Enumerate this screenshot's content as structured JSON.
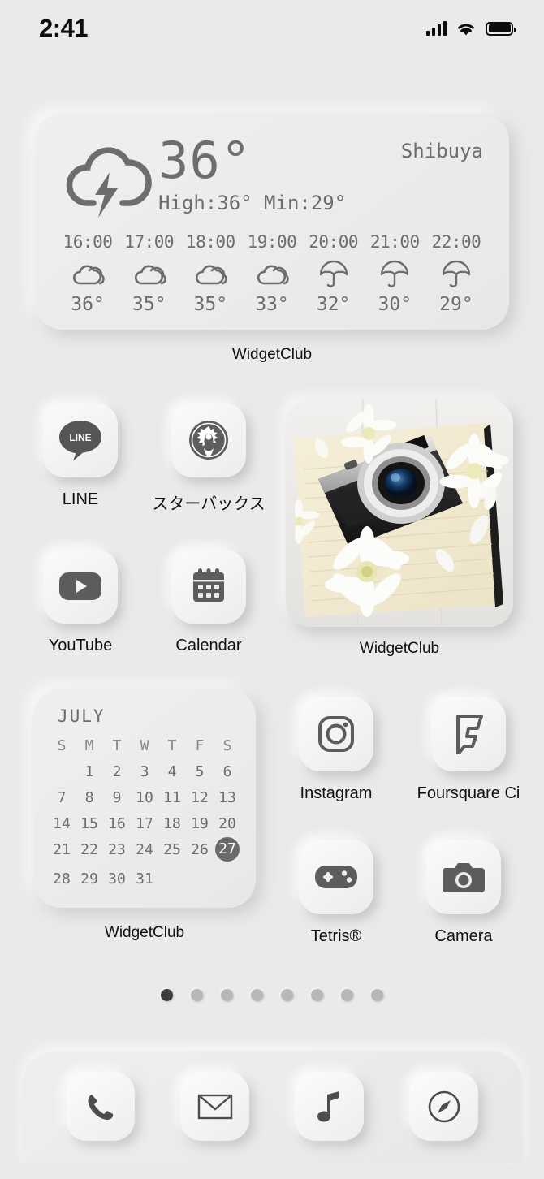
{
  "statusbar": {
    "time": "2:41",
    "signal_icon": "cellular-bars-icon",
    "wifi_icon": "wifi-icon",
    "battery_icon": "battery-full-icon"
  },
  "weather": {
    "condition_icon": "thunderstorm-icon",
    "temperature": "36°",
    "high_low": "High:36° Min:29°",
    "location": "Shibuya",
    "hourly": [
      {
        "time": "16:00",
        "icon": "cloudy-icon",
        "temp": "36°"
      },
      {
        "time": "17:00",
        "icon": "cloudy-icon",
        "temp": "35°"
      },
      {
        "time": "18:00",
        "icon": "cloudy-icon",
        "temp": "35°"
      },
      {
        "time": "19:00",
        "icon": "cloudy-icon",
        "temp": "33°"
      },
      {
        "time": "20:00",
        "icon": "umbrella-icon",
        "temp": "32°"
      },
      {
        "time": "21:00",
        "icon": "umbrella-icon",
        "temp": "30°"
      },
      {
        "time": "22:00",
        "icon": "umbrella-icon",
        "temp": "29°"
      }
    ],
    "widget_label": "WidgetClub"
  },
  "apps": {
    "line": {
      "label": "LINE",
      "icon": "line-chat-icon"
    },
    "starbucks": {
      "label": "スターバックス",
      "icon": "starbucks-siren-icon"
    },
    "youtube": {
      "label": "YouTube",
      "icon": "youtube-play-icon"
    },
    "calendar": {
      "label": "Calendar",
      "icon": "calendar-icon"
    },
    "instagram": {
      "label": "Instagram",
      "icon": "instagram-camera-icon"
    },
    "foursquare": {
      "label": "Foursquare Ci",
      "icon": "foursquare-flag-icon"
    },
    "tetris": {
      "label": "Tetris®",
      "icon": "gamepad-icon"
    },
    "camera": {
      "label": "Camera",
      "icon": "camera-icon"
    }
  },
  "photo_widget": {
    "label": "WidgetClub",
    "image_description": "vintage black film camera on a lined notebook with white chrysanthemum flowers"
  },
  "calendar_widget": {
    "month": "JULY",
    "weekdays": [
      "S",
      "M",
      "T",
      "W",
      "T",
      "F",
      "S"
    ],
    "leading_blanks": 1,
    "days": [
      1,
      2,
      3,
      4,
      5,
      6,
      7,
      8,
      9,
      10,
      11,
      12,
      13,
      14,
      15,
      16,
      17,
      18,
      19,
      20,
      21,
      22,
      23,
      24,
      25,
      26,
      27,
      28,
      29,
      30,
      31
    ],
    "today": 27,
    "label": "WidgetClub"
  },
  "page_dots": {
    "count": 8,
    "active_index": 0
  },
  "dock": {
    "items": [
      {
        "name": "Phone",
        "icon": "phone-icon"
      },
      {
        "name": "Mail",
        "icon": "mail-envelope-icon"
      },
      {
        "name": "Music",
        "icon": "music-note-icon"
      },
      {
        "name": "Safari",
        "icon": "safari-compass-icon"
      }
    ]
  },
  "colors": {
    "background": "#eaeaea",
    "icon_gray": "#6d6d6d",
    "text_dark": "#0f0f0f",
    "today_badge": "#6a6a6a"
  }
}
